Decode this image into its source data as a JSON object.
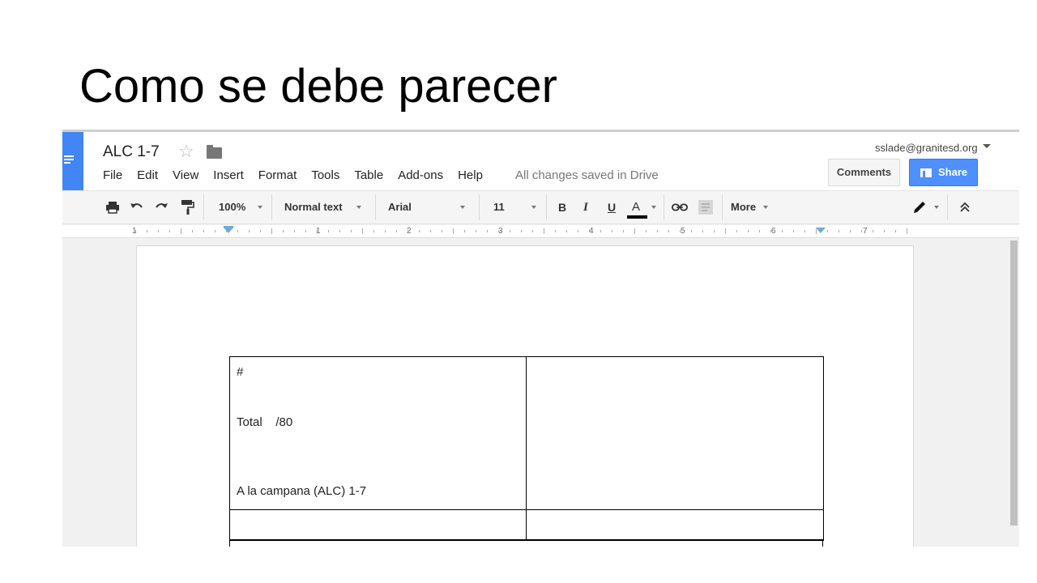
{
  "slide": {
    "title": "Como se debe parecer"
  },
  "header": {
    "doc_title": "ALC 1-7",
    "menu": [
      "File",
      "Edit",
      "View",
      "Insert",
      "Format",
      "Tools",
      "Table",
      "Add-ons",
      "Help"
    ],
    "saved_status": "All changes saved in Drive",
    "account": "sslade@granitesd.org",
    "comments_label": "Comments",
    "share_label": "Share",
    "brand_color": "#4285f4",
    "share_color": "#4d90fe"
  },
  "toolbar": {
    "zoom": "100%",
    "style": "Normal text",
    "font": "Arial",
    "size": "11",
    "bold": "B",
    "italic": "I",
    "underline": "U",
    "text_color": "A",
    "more": "More"
  },
  "ruler": {
    "numbers": [
      "1",
      "1",
      "2",
      "3",
      "4",
      "5",
      "6",
      "7"
    ]
  },
  "document": {
    "table": {
      "cell_lines": [
        "#",
        "Total    /80",
        "A la campana (ALC) 1-7"
      ]
    }
  },
  "icons": [
    "docs-logo-icon",
    "star-icon",
    "folder-icon",
    "print-icon",
    "undo-icon",
    "redo-icon",
    "paint-format-icon",
    "link-icon",
    "comment-icon",
    "pencil-icon",
    "collapse-icon",
    "dropdown-caret-icon",
    "share-people-icon"
  ]
}
